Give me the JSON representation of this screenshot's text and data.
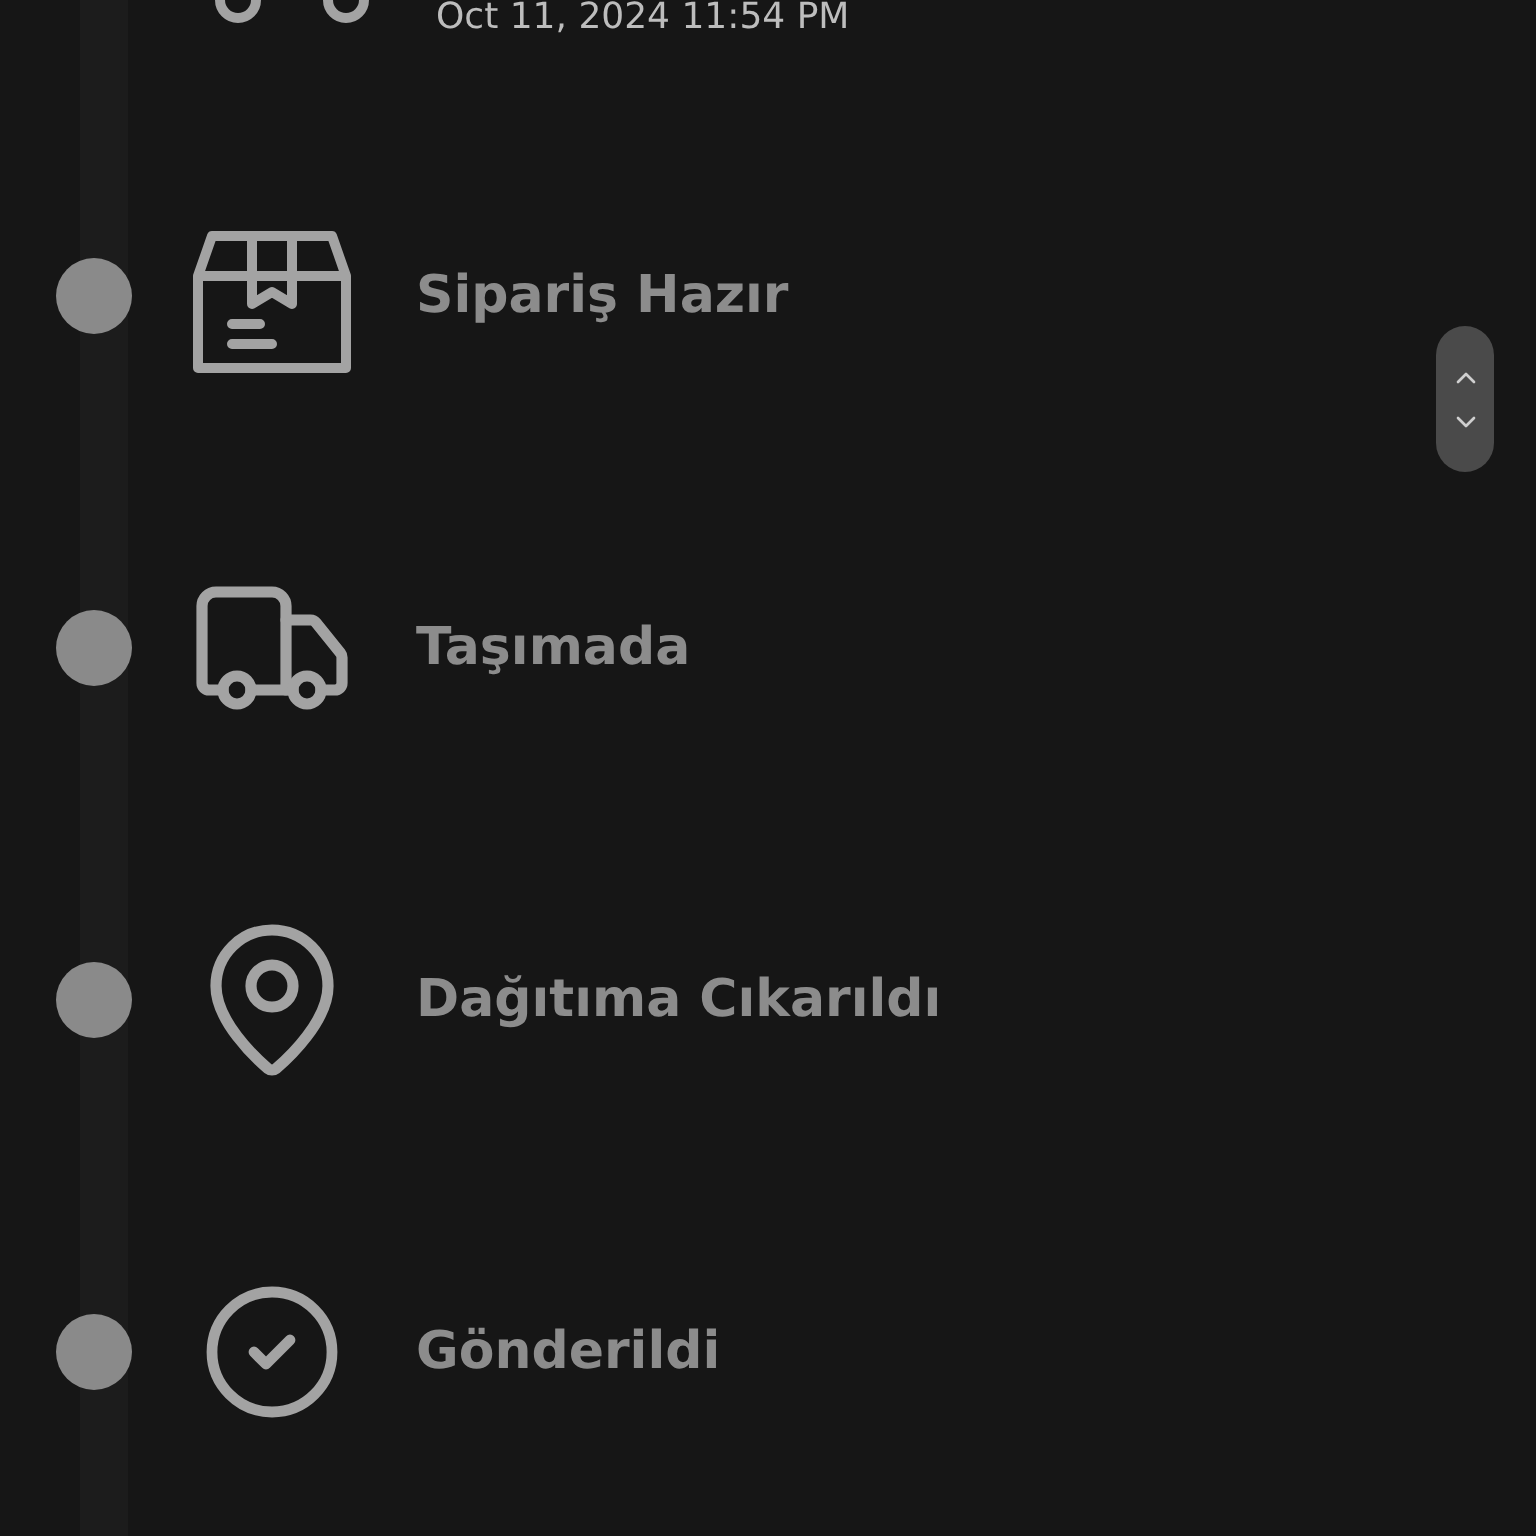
{
  "previous_step": {
    "kind": "transit",
    "time": "Oct 11, 2024 11:54 PM"
  },
  "steps": [
    {
      "kind": "ready",
      "label": "Sipariş Hazır"
    },
    {
      "kind": "transit",
      "label": "Taşımada"
    },
    {
      "kind": "out_for_delivery",
      "label": "Dağıtıma Cıkarıldı"
    },
    {
      "kind": "delivered",
      "label": "Gönderildi"
    }
  ]
}
